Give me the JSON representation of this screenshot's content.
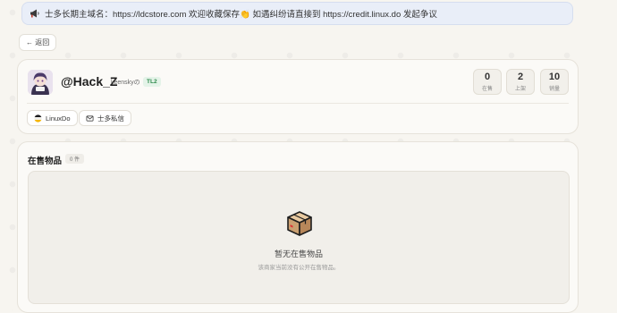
{
  "banner": {
    "icon": "megaphone-icon",
    "text": "士多长期主域名：https://ldcstore.com 欢迎收藏保存👏 如遇纠纷请直接到 https://credit.linux.do 发起争议"
  },
  "back_button": {
    "label": "← 返回"
  },
  "profile": {
    "username": "@Hack_Z",
    "nickname": "keenskyの",
    "trust_level": "TL2",
    "stats": [
      {
        "value": "0",
        "label": "在售"
      },
      {
        "value": "2",
        "label": "上架"
      },
      {
        "value": "10",
        "label": "销量"
      }
    ],
    "links": [
      {
        "label": "LinuxDo",
        "icon": "linuxdo-icon"
      },
      {
        "label": "士多私信",
        "icon": "mail-icon"
      }
    ]
  },
  "listing": {
    "title": "在售物品",
    "count_badge": "0 件",
    "empty_title": "暂无在售物品",
    "empty_subtitle": "该商家当前没有公开在售物品。"
  },
  "colors": {
    "background": "#f7f5f0",
    "banner_bg": "#e9eef8",
    "tl_badge_bg": "#e4f3e8",
    "tl_badge_text": "#2d8a4b"
  }
}
